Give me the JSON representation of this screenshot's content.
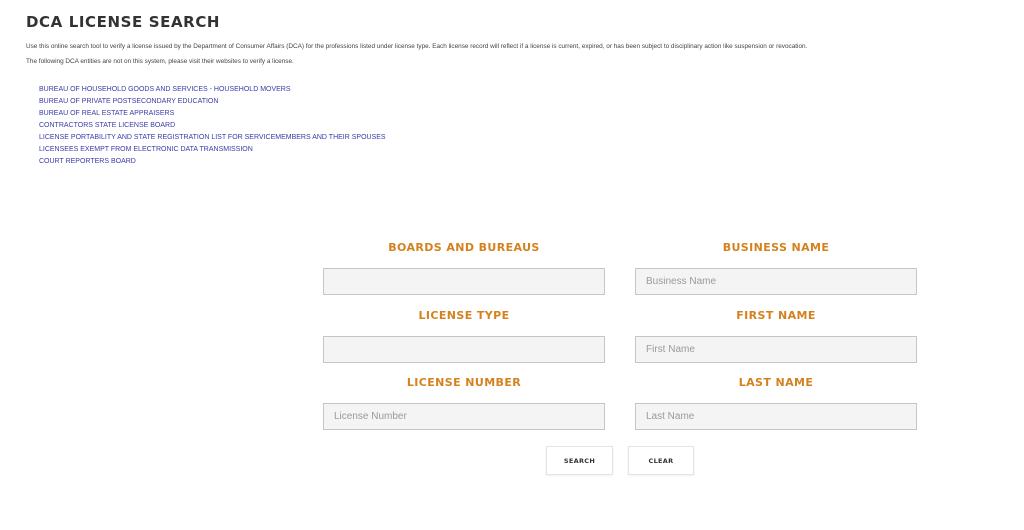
{
  "header": {
    "title": "DCA LICENSE SEARCH",
    "intro": "Use this online search tool to verify a license issued by the Department of Consumer Affairs (DCA) for the professions listed under license type. Each license record will reflect if a license is current, expired, or has been subject to disciplinary action like suspension or revocation.",
    "note": "The following DCA entities are not on this system, please visit their websites to verify a license."
  },
  "entities": [
    "BUREAU OF HOUSEHOLD GOODS AND SERVICES - HOUSEHOLD MOVERS",
    "BUREAU OF PRIVATE POSTSECONDARY EDUCATION",
    "BUREAU OF REAL ESTATE APPRAISERS",
    "CONTRACTORS STATE LICENSE BOARD",
    "LICENSE PORTABILITY AND STATE REGISTRATION LIST FOR SERVICEMEMBERS AND THEIR SPOUSES",
    "LICENSEES EXEMPT FROM ELECTRONIC DATA TRANSMISSION",
    "COURT REPORTERS BOARD"
  ],
  "form": {
    "boards": {
      "label": "BOARDS AND BUREAUS",
      "value": ""
    },
    "business_name": {
      "label": "BUSINESS NAME",
      "placeholder": "Business Name",
      "value": ""
    },
    "license_type": {
      "label": "LICENSE TYPE",
      "value": ""
    },
    "first_name": {
      "label": "FIRST NAME",
      "placeholder": "First Name",
      "value": ""
    },
    "license_number": {
      "label": "LICENSE NUMBER",
      "placeholder": "License Number",
      "value": ""
    },
    "last_name": {
      "label": "LAST NAME",
      "placeholder": "Last Name",
      "value": ""
    },
    "search_label": "SEARCH",
    "clear_label": "CLEAR"
  },
  "colors": {
    "label_accent": "#d4821e",
    "link": "#3a3aa8",
    "field_bg": "#f4f4f4"
  }
}
